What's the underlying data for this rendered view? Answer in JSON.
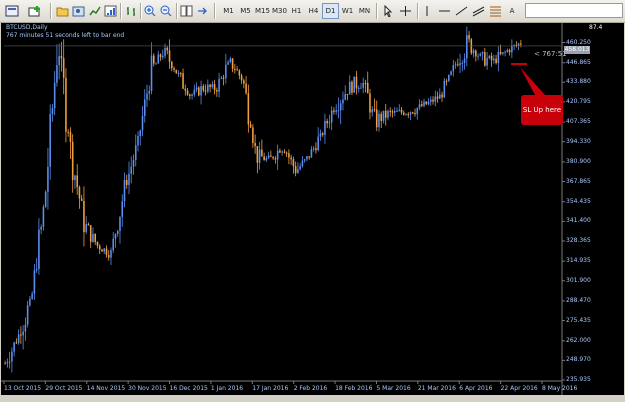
{
  "toolbar": {
    "timeframes": [
      "M1",
      "M5",
      "M15",
      "M30",
      "H1",
      "H4",
      "D1",
      "W1",
      "MN"
    ],
    "active_timeframe": "D1",
    "text_tool": "A"
  },
  "chart": {
    "symbol_label": "BTCUSD,Daily",
    "countdown_label": "767 minutes 51 seconds left to bar end",
    "top_right_value": "87.4",
    "current_price": "458.013",
    "bar_countdown": "< 767:51",
    "annotation": "SL Up here",
    "colors": {
      "background": "#000000",
      "bull": "#5b8ff0",
      "bear": "#f0a040",
      "axis": "#a8c8ff",
      "annotation": "#c8000a"
    }
  },
  "chart_data": {
    "type": "candlestick",
    "ylim": [
      235.935,
      466.6
    ],
    "y_ticks": [
      "460.250",
      "446.865",
      "433.880",
      "420.795",
      "407.365",
      "394.330",
      "380.900",
      "367.865",
      "354.435",
      "341.400",
      "328.365",
      "314.935",
      "301.900",
      "288.470",
      "275.435",
      "262.000",
      "248.970",
      "235.935"
    ],
    "x_ticks": [
      "13 Oct 2015",
      "29 Oct 2015",
      "14 Nov 2015",
      "30 Nov 2015",
      "16 Dec 2015",
      "1 Jan 2016",
      "17 Jan 2016",
      "2 Feb 2016",
      "18 Feb 2016",
      "5 Mar 2016",
      "21 Mar 2016",
      "6 Apr 2016",
      "22 Apr 2016",
      "8 May 2016"
    ],
    "levels": {
      "current": 458.013,
      "stop_loss": 446.0
    },
    "price_path": [
      {
        "date": "13 Oct 2015",
        "close": 247
      },
      {
        "date": "20 Oct 2015",
        "close": 265
      },
      {
        "date": "25 Oct 2015",
        "close": 290
      },
      {
        "date": "29 Oct 2015",
        "close": 355
      },
      {
        "date": "3 Nov 2015",
        "close": 462
      },
      {
        "date": "5 Nov 2015",
        "close": 385
      },
      {
        "date": "9 Nov 2015",
        "close": 340
      },
      {
        "date": "14 Nov 2015",
        "close": 325
      },
      {
        "date": "22 Nov 2015",
        "close": 320
      },
      {
        "date": "30 Nov 2015",
        "close": 362
      },
      {
        "date": "5 Dec 2015",
        "close": 392
      },
      {
        "date": "11 Dec 2015",
        "close": 440
      },
      {
        "date": "16 Dec 2015",
        "close": 455
      },
      {
        "date": "22 Dec 2015",
        "close": 440
      },
      {
        "date": "27 Dec 2015",
        "close": 425
      },
      {
        "date": "1 Jan 2016",
        "close": 430
      },
      {
        "date": "5 Jan 2016",
        "close": 430
      },
      {
        "date": "9 Jan 2016",
        "close": 448
      },
      {
        "date": "13 Jan 2016",
        "close": 435
      },
      {
        "date": "16 Jan 2016",
        "close": 385
      },
      {
        "date": "21 Jan 2016",
        "close": 382
      },
      {
        "date": "26 Jan 2016",
        "close": 392
      },
      {
        "date": "2 Feb 2016",
        "close": 375
      },
      {
        "date": "8 Feb 2016",
        "close": 385
      },
      {
        "date": "14 Feb 2016",
        "close": 400
      },
      {
        "date": "18 Feb 2016",
        "close": 420
      },
      {
        "date": "24 Feb 2016",
        "close": 430
      },
      {
        "date": "28 Feb 2016",
        "close": 435
      },
      {
        "date": "5 Mar 2016",
        "close": 408
      },
      {
        "date": "10 Mar 2016",
        "close": 413
      },
      {
        "date": "21 Mar 2016",
        "close": 414
      },
      {
        "date": "28 Mar 2016",
        "close": 416
      },
      {
        "date": "6 Apr 2016",
        "close": 420
      },
      {
        "date": "14 Apr 2016",
        "close": 425
      },
      {
        "date": "20 Apr 2016",
        "close": 445
      },
      {
        "date": "24 Apr 2016",
        "close": 460
      },
      {
        "date": "30 Apr 2016",
        "close": 450
      },
      {
        "date": "4 May 2016",
        "close": 448
      },
      {
        "date": "8 May 2016",
        "close": 455
      },
      {
        "date": "12 May 2016",
        "close": 460
      }
    ]
  }
}
